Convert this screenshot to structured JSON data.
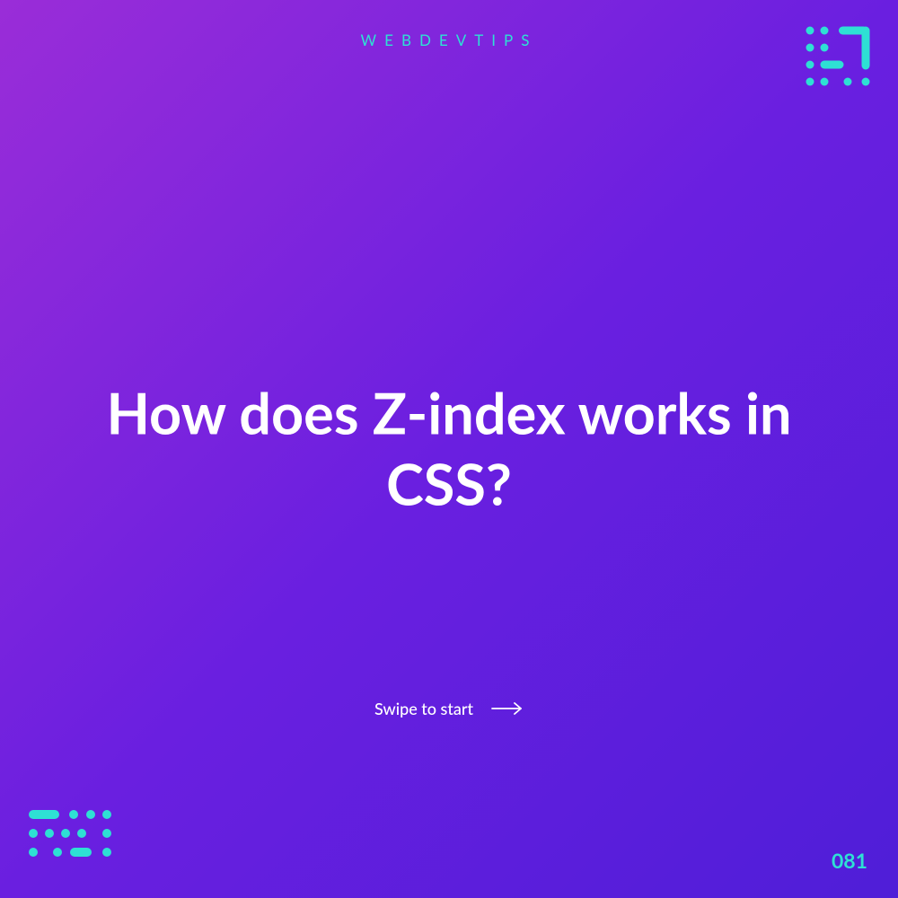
{
  "brand": "WEBDEVTIPS",
  "title": "How does Z-index works in CSS?",
  "swipe_label": "Swipe to start",
  "page_number": "081",
  "accent_color": "#2ee0d4"
}
